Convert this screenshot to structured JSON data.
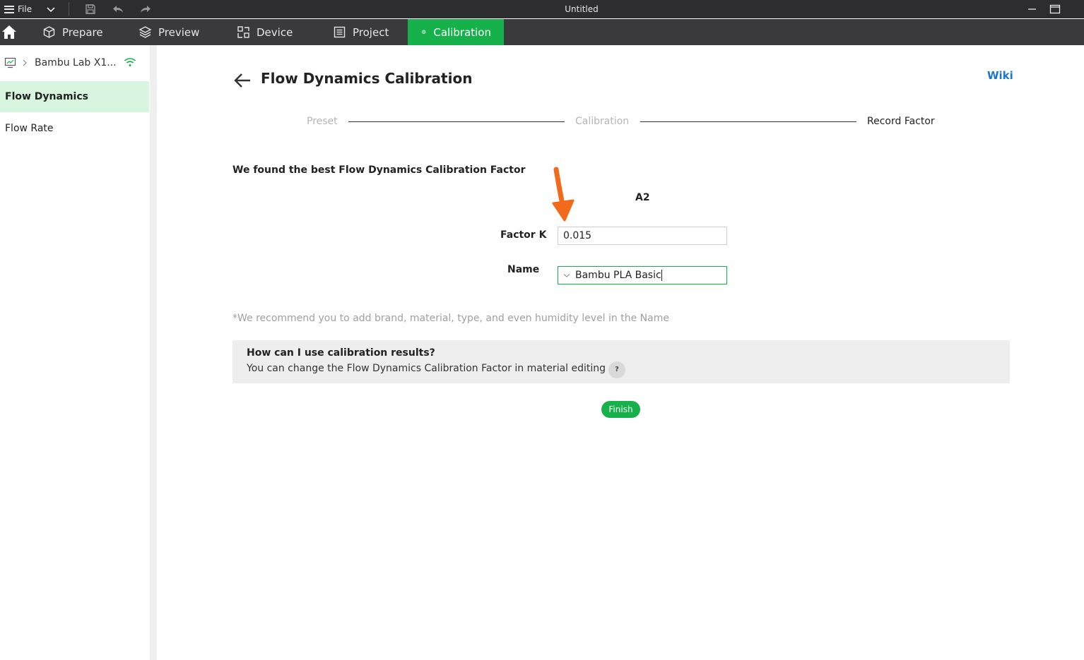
{
  "titlebar": {
    "file_label": "File",
    "window_title": "Untitled"
  },
  "nav": {
    "tabs": [
      {
        "label": "Prepare",
        "icon": "cube-icon"
      },
      {
        "label": "Preview",
        "icon": "layers-icon"
      },
      {
        "label": "Device",
        "icon": "device-icon"
      },
      {
        "label": "Project",
        "icon": "project-icon"
      },
      {
        "label": "Calibration",
        "icon": "calibration-icon",
        "active": true
      }
    ]
  },
  "sidebar": {
    "device_name": "Bambu Lab X1...",
    "items": [
      {
        "label": "Flow Dynamics",
        "active": true
      },
      {
        "label": "Flow Rate"
      }
    ]
  },
  "main": {
    "title": "Flow Dynamics Calibration",
    "wiki_label": "Wiki",
    "steps": [
      {
        "label": "Preset",
        "state": "done"
      },
      {
        "label": "Calibration",
        "state": "done"
      },
      {
        "label": "Record Factor",
        "state": "current"
      }
    ],
    "found_text": "We found the best Flow Dynamics Calibration Factor",
    "slot_label": "A2",
    "factor_label": "Factor K",
    "factor_value": "0.015",
    "name_label": "Name",
    "name_value": "Bambu PLA Basic",
    "recommend_text": "*We recommend you to add brand, material, type, and even humidity level in the Name",
    "info_title": "How can I use calibration results?",
    "info_text": "You can change the Flow Dynamics Calibration Factor in material editing",
    "help_label": "?",
    "finish_label": "Finish"
  },
  "colors": {
    "accent": "#16b14a",
    "titlebar_bg": "#2d2d2f",
    "navbar_bg": "#3a3a3c",
    "sidebar_active_bg": "#d7f5df",
    "link": "#1976d2",
    "annotation_arrow": "#f26a1b"
  }
}
